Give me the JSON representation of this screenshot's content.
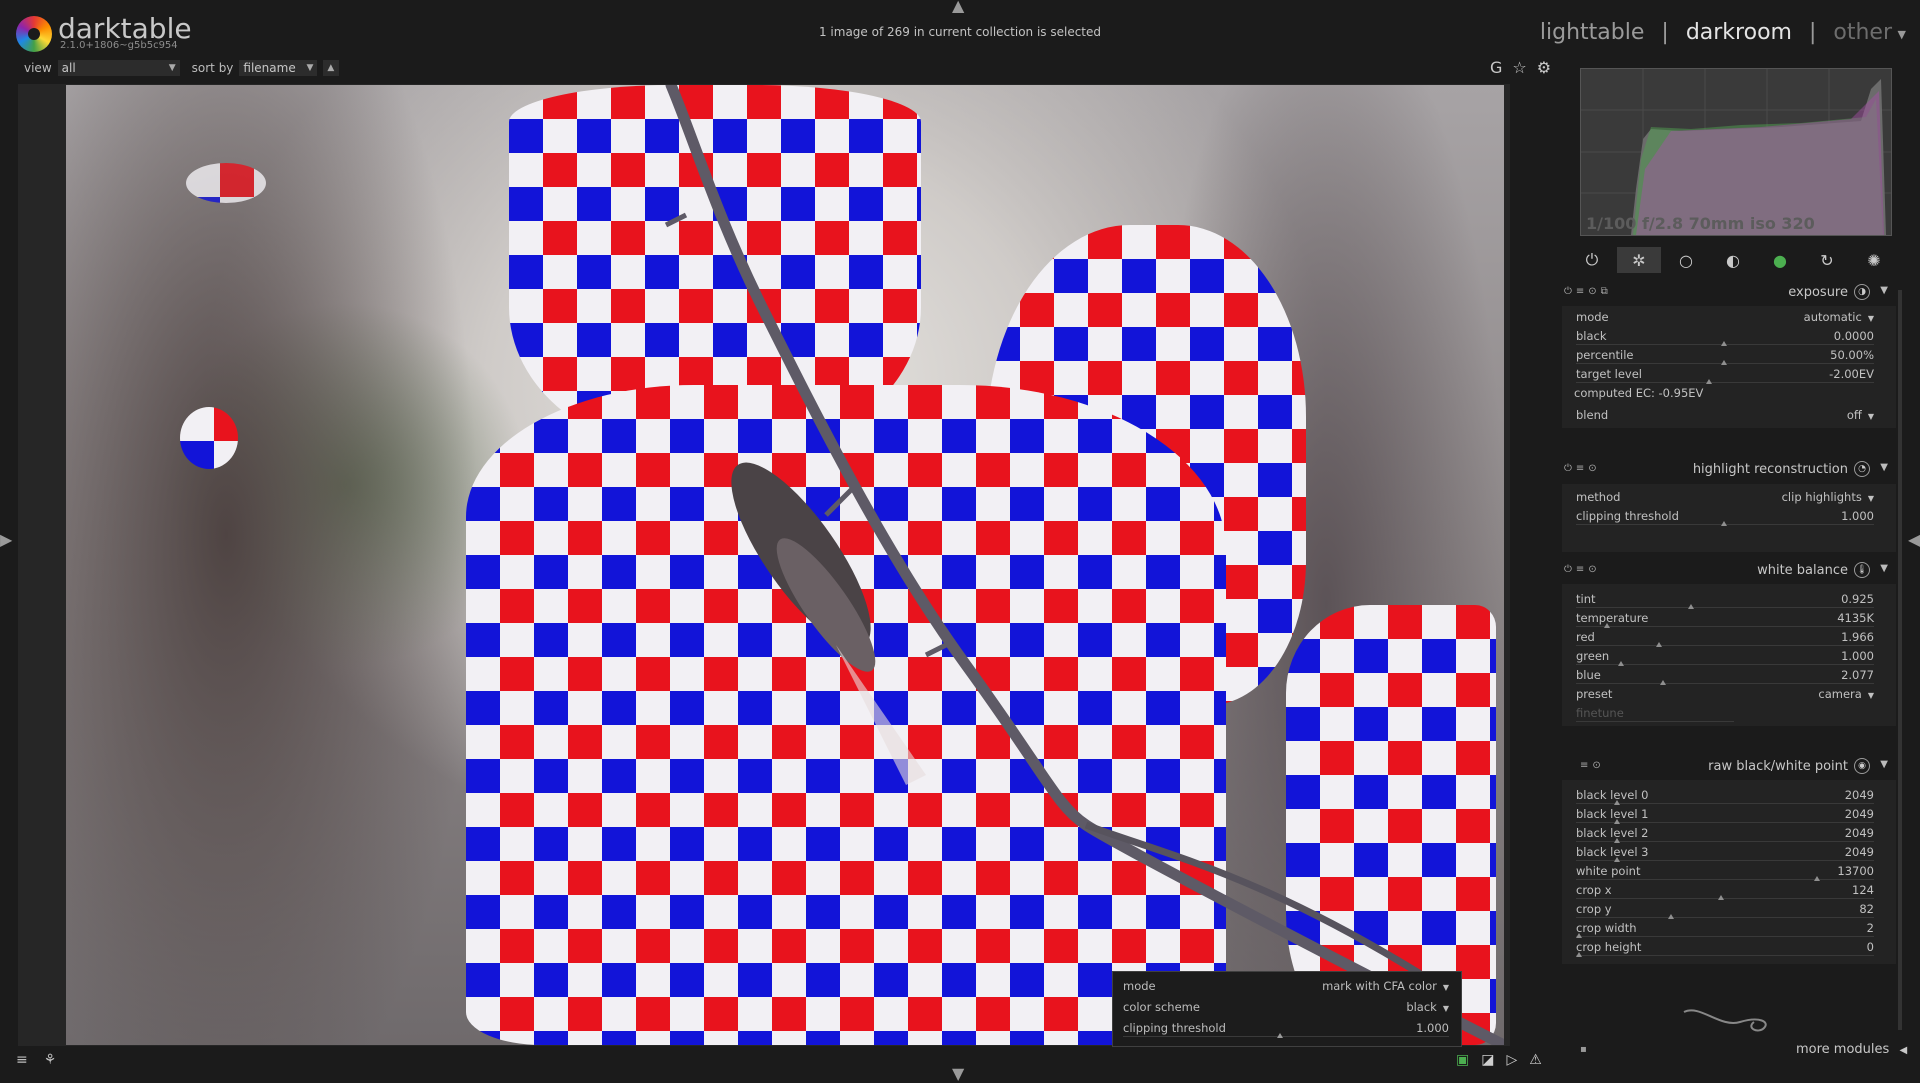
{
  "app": {
    "name": "darktable",
    "version": "2.1.0+1806~g5b5c954"
  },
  "status": "1 image of 269 in current collection is selected",
  "views": {
    "lighttable": "lighttable",
    "darkroom": "darkroom",
    "other": "other",
    "separator": "|"
  },
  "filterbar": {
    "view_label": "view",
    "view_value": "all",
    "sort_label": "sort by",
    "sort_value": "filename"
  },
  "top_icons": {
    "grouping": "G",
    "star": "☆",
    "gear": "⚙"
  },
  "histogram": {
    "info": "1/100 f/2.8 70mm iso 320"
  },
  "group_tabs": [
    "power-icon",
    "favorite-icon",
    "basic-circle-icon",
    "tone-icon",
    "color-icon",
    "correct-icon",
    "effect-icon"
  ],
  "modules": {
    "exposure": {
      "title": "exposure",
      "rows": [
        {
          "label": "mode",
          "value": "automatic"
        },
        {
          "label": "black",
          "value": "0.0000"
        },
        {
          "label": "percentile",
          "value": "50.00%"
        },
        {
          "label": "target level",
          "value": "-2.00EV"
        }
      ],
      "computed": "computed EC: -0.95EV",
      "blend": {
        "label": "blend",
        "value": "off"
      }
    },
    "highlight": {
      "title": "highlight reconstruction",
      "rows": [
        {
          "label": "method",
          "value": "clip highlights"
        },
        {
          "label": "clipping threshold",
          "value": "1.000"
        }
      ]
    },
    "whitebalance": {
      "title": "white balance",
      "rows": [
        {
          "label": "tint",
          "value": "0.925"
        },
        {
          "label": "temperature",
          "value": "4135K"
        },
        {
          "label": "red",
          "value": "1.966"
        },
        {
          "label": "green",
          "value": "1.000"
        },
        {
          "label": "blue",
          "value": "2.077"
        },
        {
          "label": "preset",
          "value": "camera"
        },
        {
          "label": "finetune",
          "value": ""
        }
      ]
    },
    "rawbw": {
      "title": "raw black/white point",
      "rows": [
        {
          "label": "black level 0",
          "value": "2049"
        },
        {
          "label": "black level 1",
          "value": "2049"
        },
        {
          "label": "black level 2",
          "value": "2049"
        },
        {
          "label": "black level 3",
          "value": "2049"
        },
        {
          "label": "white point",
          "value": "13700"
        },
        {
          "label": "crop x",
          "value": "124"
        },
        {
          "label": "crop y",
          "value": "82"
        },
        {
          "label": "crop width",
          "value": "2"
        },
        {
          "label": "crop height",
          "value": "0"
        }
      ]
    }
  },
  "more_modules": "more modules",
  "clipping_popup": {
    "rows": [
      {
        "label": "mode",
        "value": "mark with CFA color"
      },
      {
        "label": "color scheme",
        "value": "black"
      },
      {
        "label": "clipping threshold",
        "value": "1.000"
      }
    ]
  },
  "colors": {
    "checker_red": "#e8131d",
    "checker_blue": "#1214d8",
    "checker_white": "#f2f0f4",
    "panel_bg": "#1b1b1b"
  }
}
